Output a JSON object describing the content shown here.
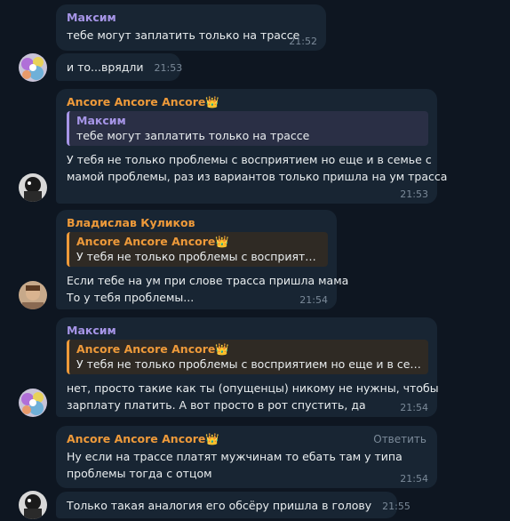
{
  "colors": {
    "background": "#0e1621",
    "bubble": "#182533",
    "name_maksim": "#a695e7",
    "name_ancore": "#ee9a3a",
    "name_vladislav": "#ee9a3a",
    "timestamp": "#7b8a99"
  },
  "messages": [
    {
      "sender": "Максим",
      "text": "тебе могут заплатить только на трассе",
      "time": "21:52"
    },
    {
      "text": "и то...врядли",
      "time": "21:53"
    },
    {
      "sender": "Ancore Ancore Ancore👑",
      "quote": {
        "name": "Максим",
        "text": "тебе могут заплатить только на трассе"
      },
      "lines": [
        "У тебя не только проблемы с восприятием но еще и в семье с",
        "мамой проблемы, раз из вариантов только пришла на ум трасса"
      ],
      "time": "21:53"
    },
    {
      "sender": "Владислав Куликов",
      "quote": {
        "name": "Ancore Ancore Ancore👑",
        "text": "У тебя не только проблемы с восприятием..."
      },
      "lines": [
        "Если тебе на ум при слове трасса пришла мама",
        "То у тебя проблемы..."
      ],
      "time": "21:54"
    },
    {
      "sender": "Максим",
      "quote": {
        "name": "Ancore Ancore Ancore👑",
        "text": "У тебя не только проблемы с восприятием но еще и в семье ..."
      },
      "lines": [
        "нет, просто такие как ты (опущенцы) никому не нужны, чтобы",
        "зарплату платить. А вот просто в рот спустить, да"
      ],
      "time": "21:54"
    },
    {
      "sender": "Ancore Ancore Ancore👑",
      "reply_label": "Ответить",
      "lines": [
        "Ну если на трассе платят мужчинам то ебать там у типа",
        "проблемы тогда с отцом"
      ],
      "time": "21:54"
    },
    {
      "text": "Только такая аналогия его обсёру пришла в голову",
      "time": "21:55"
    }
  ]
}
